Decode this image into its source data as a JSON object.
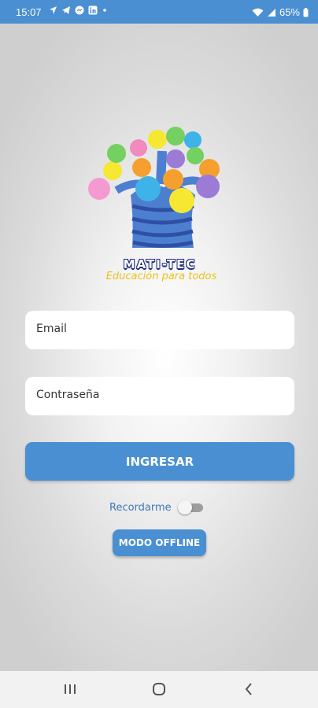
{
  "status_bar": {
    "time": "15:07",
    "battery": "65%",
    "notification_icons": [
      "location-icon",
      "telegram-icon",
      "messenger-icon",
      "linkedin-icon",
      "dot-icon"
    ],
    "status_icons": [
      "wifi-icon",
      "signal-icon",
      "battery-icon"
    ]
  },
  "app": {
    "brand": "MATI-TEC",
    "tagline": "Educación para todos"
  },
  "login_form": {
    "email_placeholder": "Email",
    "password_placeholder": "Contraseña",
    "login_button": "INGRESAR",
    "remember_label": "Recordarme",
    "remember_checked": false,
    "offline_button": "MODO OFFLINE"
  },
  "nav_bar": {
    "items": [
      "recents-icon",
      "home-icon",
      "back-icon"
    ]
  },
  "colors": {
    "primary": "#4a8fd1",
    "status_bar": "#4a8fd1",
    "brand_blue": "#1d2c7c",
    "tagline_yellow": "#e8c21a"
  }
}
